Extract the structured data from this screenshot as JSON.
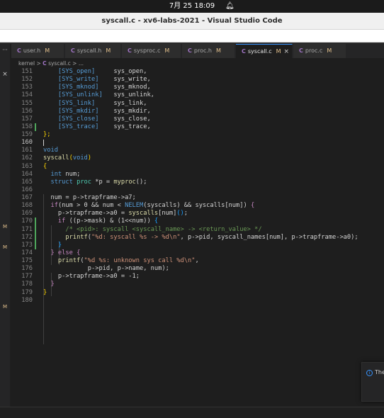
{
  "system": {
    "clock": "7月 25  18:09",
    "notification_icon": "bell-icon"
  },
  "window": {
    "title": "syscall.c - xv6-labs-2021 - Visual Studio Code"
  },
  "activity_bar": {
    "dots": "···",
    "close": "×",
    "markers": [
      "M",
      "M",
      "M"
    ]
  },
  "tabs": [
    {
      "name": "user.h",
      "badge": "M"
    },
    {
      "name": "syscall.h",
      "badge": "M"
    },
    {
      "name": "sysproc.c",
      "badge": "M"
    },
    {
      "name": "proc.h",
      "badge": "M"
    },
    {
      "name": "syscall.c",
      "badge": "M",
      "close": "×",
      "active": true
    },
    {
      "name": "proc.c",
      "badge": "M"
    }
  ],
  "breadcrumb": {
    "folder": "kernel",
    "sep": ">",
    "icon": "C",
    "file": "syscall.c",
    "more": "..."
  },
  "editor": {
    "current_line": 160,
    "lines": [
      {
        "n": 151,
        "tokens": [
          [
            "    ",
            ""
          ],
          [
            "[SYS_open]",
            "c"
          ],
          [
            "     sys_open,",
            "d"
          ]
        ]
      },
      {
        "n": 152,
        "tokens": [
          [
            "    ",
            ""
          ],
          [
            "[SYS_write]",
            "c"
          ],
          [
            "    sys_write,",
            "d"
          ]
        ]
      },
      {
        "n": 153,
        "tokens": [
          [
            "    ",
            ""
          ],
          [
            "[SYS_mknod]",
            "c"
          ],
          [
            "    sys_mknod,",
            "d"
          ]
        ]
      },
      {
        "n": 154,
        "tokens": [
          [
            "    ",
            ""
          ],
          [
            "[SYS_unlink]",
            "c"
          ],
          [
            "   sys_unlink,",
            "d"
          ]
        ]
      },
      {
        "n": 155,
        "tokens": [
          [
            "    ",
            ""
          ],
          [
            "[SYS_link]",
            "c"
          ],
          [
            "     sys_link,",
            "d"
          ]
        ]
      },
      {
        "n": 156,
        "tokens": [
          [
            "    ",
            ""
          ],
          [
            "[SYS_mkdir]",
            "c"
          ],
          [
            "    sys_mkdir,",
            "d"
          ]
        ]
      },
      {
        "n": 157,
        "tokens": [
          [
            "    ",
            ""
          ],
          [
            "[SYS_close]",
            "c"
          ],
          [
            "    sys_close,",
            "d"
          ]
        ]
      },
      {
        "n": 158,
        "gutter": "add",
        "tokens": [
          [
            "    ",
            ""
          ],
          [
            "[SYS_trace]",
            "c"
          ],
          [
            "    sys_trace,",
            "d"
          ]
        ]
      },
      {
        "n": 159,
        "tokens": [
          [
            "};",
            "y"
          ]
        ]
      },
      {
        "n": 160,
        "cursor": true,
        "tokens": []
      },
      {
        "n": 161,
        "tokens": [
          [
            "void",
            "k"
          ]
        ]
      },
      {
        "n": 162,
        "tokens": [
          [
            "syscall",
            "f"
          ],
          [
            "(",
            "y"
          ],
          [
            "void",
            "k"
          ],
          [
            ")",
            "y"
          ]
        ]
      },
      {
        "n": 163,
        "tokens": [
          [
            "{",
            "y"
          ]
        ]
      },
      {
        "n": 164,
        "tokens": [
          [
            "  ",
            ""
          ],
          [
            "int",
            "k"
          ],
          [
            " num;",
            "d"
          ]
        ]
      },
      {
        "n": 165,
        "tokens": [
          [
            "  ",
            ""
          ],
          [
            "struct",
            "k"
          ],
          [
            " ",
            ""
          ],
          [
            "proc",
            "t"
          ],
          [
            " *p = ",
            "d"
          ],
          [
            "myproc",
            "f"
          ],
          [
            "();",
            "d"
          ]
        ]
      },
      {
        "n": 166,
        "tokens": []
      },
      {
        "n": 167,
        "tokens": [
          [
            "  num = p->trapframe->a7;",
            "d"
          ]
        ]
      },
      {
        "n": 168,
        "tokens": [
          [
            "  ",
            ""
          ],
          [
            "if",
            "p"
          ],
          [
            "(num > 0 && num < ",
            "d"
          ],
          [
            "NELEM",
            "k"
          ],
          [
            "(syscalls) && syscalls[num]) ",
            "d"
          ],
          [
            "{",
            "p"
          ]
        ]
      },
      {
        "n": 169,
        "tokens": [
          [
            "    p->trapframe->a0 = ",
            "d"
          ],
          [
            "syscalls",
            "f"
          ],
          [
            "[num]",
            "d"
          ],
          [
            "()",
            "b"
          ],
          [
            ";",
            "d"
          ]
        ]
      },
      {
        "n": 170,
        "gutter": "add",
        "tokens": [
          [
            "    ",
            ""
          ],
          [
            "if",
            "p"
          ],
          [
            " ((p->mask) & (1<<num)) ",
            "d"
          ],
          [
            "{",
            "b"
          ]
        ]
      },
      {
        "n": 171,
        "gutter": "add",
        "tokens": [
          [
            "      ",
            ""
          ],
          [
            "/* <pid>: syscall <syscall_name> -> <return_value> */",
            "g"
          ]
        ]
      },
      {
        "n": 172,
        "gutter": "add",
        "tokens": [
          [
            "      ",
            ""
          ],
          [
            "printf",
            "f"
          ],
          [
            "(",
            "d"
          ],
          [
            "\"%d: syscall %s -> %d\\n\"",
            "s"
          ],
          [
            ", p->pid, syscall_names[num], p->trapframe->a0);",
            "d"
          ]
        ]
      },
      {
        "n": 173,
        "gutter": "add",
        "tokens": [
          [
            "    ",
            ""
          ],
          [
            "}",
            "b"
          ]
        ]
      },
      {
        "n": 174,
        "tokens": [
          [
            "  ",
            ""
          ],
          [
            "}",
            "p"
          ],
          [
            " else ",
            "p"
          ],
          [
            "{",
            "p"
          ]
        ]
      },
      {
        "n": 175,
        "tokens": [
          [
            "    ",
            ""
          ],
          [
            "printf",
            "f"
          ],
          [
            "(",
            "d"
          ],
          [
            "\"%d %s: unknown sys call %d\\n\"",
            "s"
          ],
          [
            ",",
            "d"
          ]
        ]
      },
      {
        "n": 176,
        "tokens": [
          [
            "            p->pid, p->name, num);",
            "d"
          ]
        ]
      },
      {
        "n": 177,
        "tokens": [
          [
            "    p->trapframe->a0 = -1;",
            "d"
          ]
        ]
      },
      {
        "n": 178,
        "tokens": [
          [
            "  ",
            ""
          ],
          [
            "}",
            "p"
          ]
        ]
      },
      {
        "n": 179,
        "tokens": [
          [
            "}",
            "y"
          ]
        ]
      },
      {
        "n": 180,
        "tokens": []
      }
    ]
  },
  "notification": {
    "icon": "info-icon",
    "text": "The"
  },
  "colors": {
    "c": "#569cd6",
    "d": "#d4d4d4",
    "y": "#ffd700",
    "k": "#569cd6",
    "f": "#dcdcaa",
    "t": "#4ec9b0",
    "p": "#c586c0",
    "b": "#179fff",
    "s": "#ce9178",
    "g": "#6a9955",
    "accent": "#3794ff",
    "modified": "#e2c08d",
    "added": "#4ea65c"
  }
}
